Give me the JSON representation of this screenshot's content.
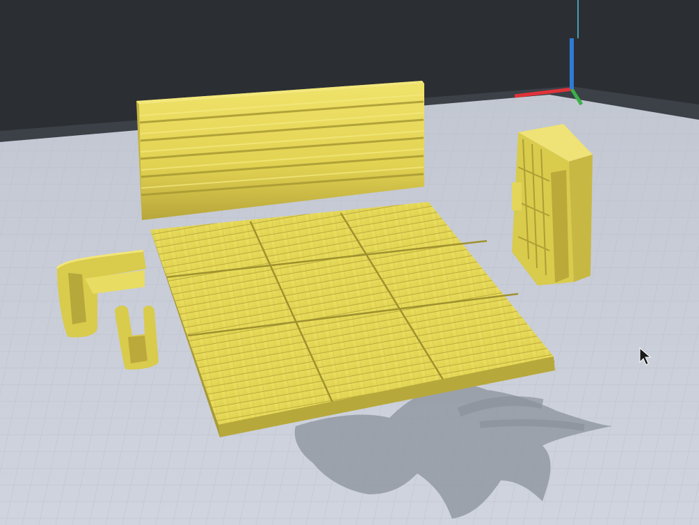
{
  "viewport": {
    "background_color": "#2b2e33",
    "build_plate_color": "#c5cad6",
    "grid_line_color": "#b3b9c6",
    "model_color": "#e6d85a",
    "model_shadow_color": "#b7a93e",
    "axis_colors": {
      "x": "#e0323a",
      "y": "#3bb04a",
      "z": "#2f7bd6"
    }
  },
  "objects": [
    {
      "name": "wall-panel",
      "kind": "log-wall"
    },
    {
      "name": "floor-tiles",
      "kind": "plank-floor"
    },
    {
      "name": "bookshelf",
      "kind": "shelf"
    },
    {
      "name": "sofa-corner",
      "kind": "sofa"
    },
    {
      "name": "chair",
      "kind": "chair"
    }
  ],
  "cursor": {
    "icon": "arrow-cursor-icon"
  }
}
